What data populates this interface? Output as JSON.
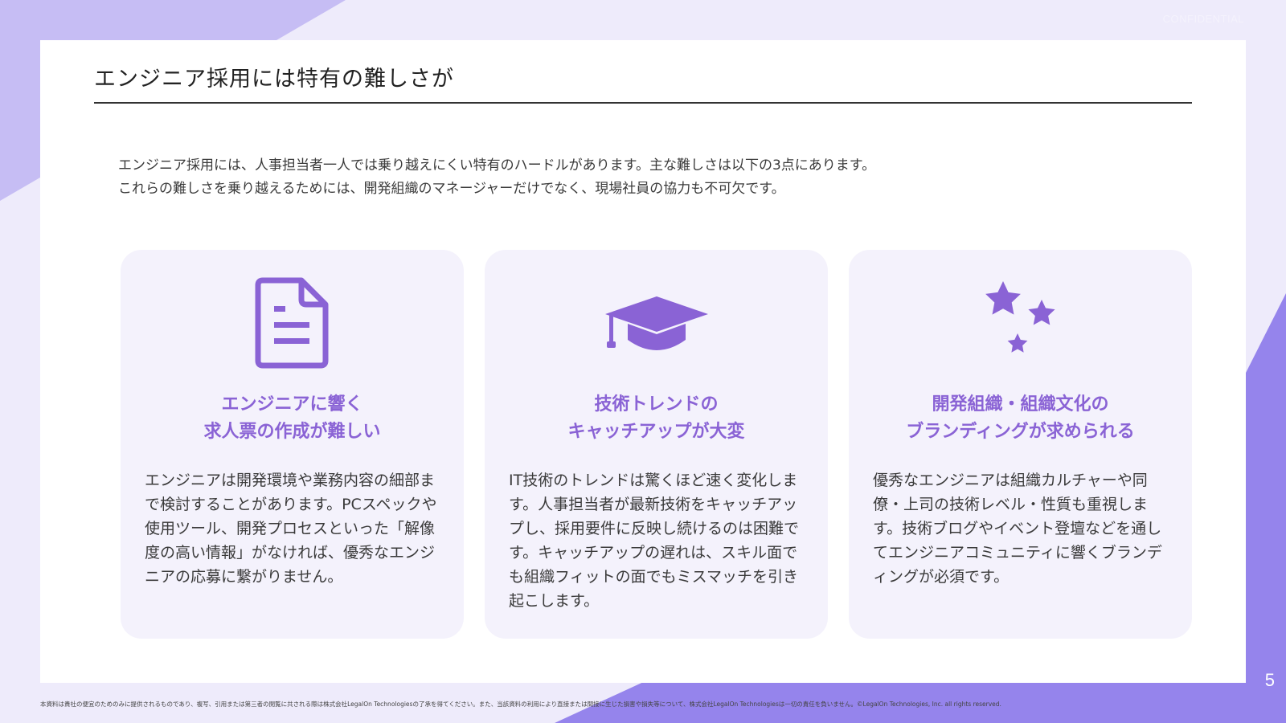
{
  "header": {
    "confidential": "CONFIDENTIAL",
    "title": "エンジニア採用には特有の難しさが"
  },
  "intro": {
    "line1": "エンジニア採用には、人事担当者一人では乗り越えにくい特有のハードルがあります。主な難しさは以下の3点にあります。",
    "line2": "これらの難しさを乗り越えるためには、開発組織のマネージャーだけでなく、現場社員の協力も不可欠です。"
  },
  "cards": [
    {
      "icon": "document-icon",
      "heading1": "エンジニアに響く",
      "heading2": "求人票の作成が難しい",
      "body": "エンジニアは開発環境や業務内容の細部まで検討することがあります。PCスペックや使用ツール、開発プロセスといった「解像度の高い情報」がなければ、優秀なエンジニアの応募に繋がりません。"
    },
    {
      "icon": "graduation-cap-icon",
      "heading1": "技術トレンドの",
      "heading2": "キャッチアップが大変",
      "body": "IT技術のトレンドは驚くほど速く変化します。人事担当者が最新技術をキャッチアップし、採用要件に反映し続けるのは困難です。キャッチアップの遅れは、スキル面でも組織フィットの面でもミスマッチを引き起こします。"
    },
    {
      "icon": "stars-icon",
      "heading1": "開発組織・組織文化の",
      "heading2": "ブランディングが求められる",
      "body": "優秀なエンジニアは組織カルチャーや同僚・上司の技術レベル・性質も重視します。技術ブログやイベント登壇などを通してエンジニアコミュニティに響くブランディングが必須です。"
    }
  ],
  "footer": {
    "page_number": "5",
    "note": "本資料は貴社の便宜のためのみに提供されるものであり、複写、引用または第三者の閲覧に共される際は株式会社LegalOn Technologiesの了承を得てください。また、当該資料の利用により直接または間接に生じた損害や損失等について、株式会社LegalOn Technologiesは一切の責任を負いません。©LegalOn Technologies, Inc. all rights reserved."
  },
  "colors": {
    "accent": "#8a63d5",
    "card_bg": "#f4f2fc",
    "page_bg": "#eeebfb",
    "deco_light": "#c6bdf4",
    "deco_dark": "#9584ec"
  }
}
